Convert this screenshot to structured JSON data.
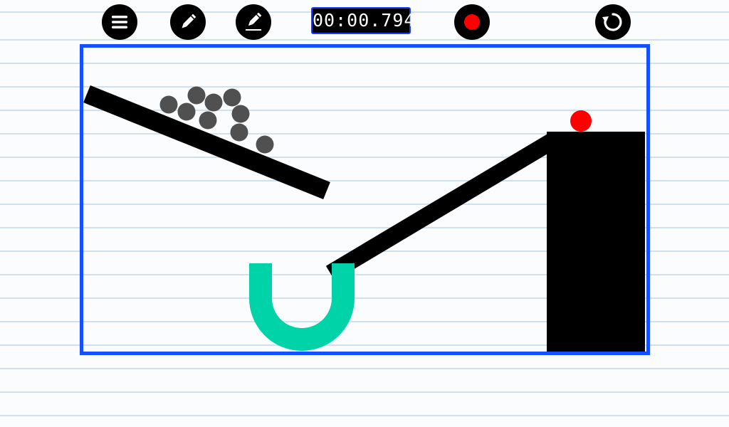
{
  "toolbar": {
    "menu_button": {
      "icon": "hamburger-menu-icon"
    },
    "draw_button": {
      "icon": "pencil-icon"
    },
    "draw_line_button": {
      "icon": "pencil-line-icon"
    },
    "record_button": {
      "icon": "record-icon",
      "color": "#ff0000"
    },
    "restart_button": {
      "icon": "restart-icon"
    }
  },
  "timer": {
    "value": "00:00.794"
  },
  "level": {
    "frame_color": "#1450ff",
    "ball_cluster_count": 10,
    "ball_color": "#505050",
    "target_ball_color": "#ff0000",
    "cup_color": "#00d3a8",
    "solid_color": "#000000",
    "paper_line_color": "#cfe0ee"
  }
}
